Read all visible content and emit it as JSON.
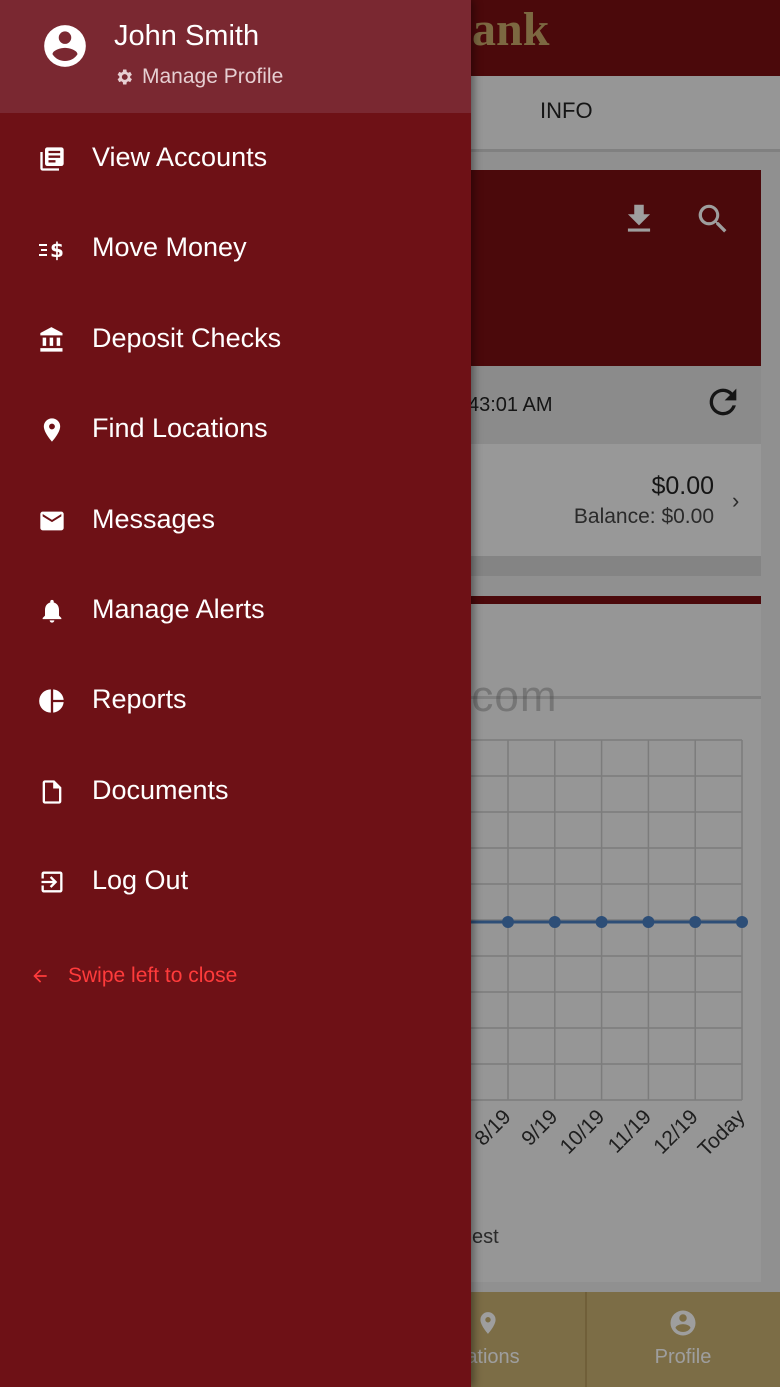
{
  "background_app": {
    "logo_text": "ank",
    "tab_label": "INFO",
    "sync_text": "43:01 AM",
    "account": {
      "amount": "$0.00",
      "balance": "Balance: $0.00"
    },
    "chart_legend": "est",
    "bottom_nav": [
      {
        "label": "cations",
        "icon": "location-pin-icon"
      },
      {
        "label": "Profile",
        "icon": "account-circle-icon"
      }
    ]
  },
  "chart_data": {
    "type": "line",
    "categories": [
      "8/19",
      "9/19",
      "10/19",
      "11/19",
      "12/19",
      "Today"
    ],
    "series": [
      {
        "values": [
          0,
          0,
          0,
          0,
          0,
          0
        ]
      }
    ],
    "line_color": "#4a7fc1",
    "grid": true
  },
  "watermark": "UpdateStar.com",
  "drawer": {
    "user_name": "John Smith",
    "manage_profile": "Manage Profile",
    "menu": [
      {
        "label": "View Accounts",
        "icon": "accounts-list-icon"
      },
      {
        "label": "Move Money",
        "icon": "transfer-money-icon"
      },
      {
        "label": "Deposit Checks",
        "icon": "bank-icon"
      },
      {
        "label": "Find Locations",
        "icon": "location-pin-icon"
      },
      {
        "label": "Messages",
        "icon": "envelope-icon"
      },
      {
        "label": "Manage Alerts",
        "icon": "bell-icon"
      },
      {
        "label": "Reports",
        "icon": "pie-chart-icon"
      },
      {
        "label": "Documents",
        "icon": "document-icon"
      },
      {
        "label": "Log Out",
        "icon": "logout-icon"
      }
    ],
    "swipe_hint": "Swipe left to close"
  },
  "colors": {
    "drawer_bg": "#6e1116",
    "drawer_header_bg": "#7a2831",
    "brand_maroon": "#7a0f12",
    "bottom_nav_gold": "#c9b072",
    "swipe_hint": "#ff3b3b"
  }
}
